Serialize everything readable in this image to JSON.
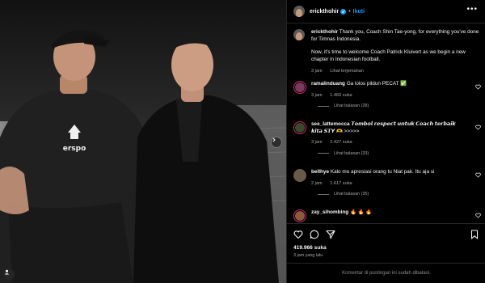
{
  "post": {
    "username": "erickthohir",
    "follow_label": "Ikuti",
    "separator": "•",
    "more_label": "•••",
    "caption_line1": "Thank you, Coach Shin Tae-yong, for everything you've done for Timnas Indonesia.",
    "caption_line2": "Now, it's time to welcome Coach Patrick Kluivert as we begin a new chapter in Indonesian football.",
    "caption_time": "3 jam",
    "translate_label": "Lihat terjemahan"
  },
  "photo": {
    "shirt_brand": "erspo"
  },
  "comments": [
    {
      "username": "ramalinduang",
      "text": "Ga lolos pildun PECAT ✅",
      "time": "3 jam",
      "likes": "1.460 suka",
      "replies": "Lihat balasan (28)",
      "avatar_color": "#7a3a5c",
      "story_ring": true
    },
    {
      "username": "see_lattemocca",
      "text": "𝙏𝙤𝙢𝙗𝙤𝙡 𝙧𝙚𝙨𝙥𝙚𝙘𝙩 𝙪𝙣𝙩𝙪𝙠 𝘾𝙤𝙖𝙘𝙝 𝙩𝙚𝙧𝙗𝙖𝙞𝙠 𝙠𝙞𝙩𝙖 𝙎𝙏𝙔 🫶 >>>>>",
      "time": "3 jam",
      "likes": "2.427 suka",
      "replies": "Lihat balasan (33)",
      "avatar_color": "#3b4a2a",
      "story_ring": true
    },
    {
      "username": "bellhye",
      "text": "Kalo mo apresiasi orang tu Niat pak. Itu aja si",
      "time": "2 jam",
      "likes": "1.617 suka",
      "replies": "Lihat balasan (35)",
      "avatar_color": "#6b5a4a",
      "story_ring": false
    },
    {
      "username": "zay_sihombing",
      "text": "🔥 🔥 🔥",
      "avatar_color": "#8a5a3a",
      "story_ring": true
    }
  ],
  "stats": {
    "likes": "419.966 suka",
    "time_ago": "3 jam yang lalu"
  },
  "footer": {
    "note": "Komentar di postingan ini sudah dibatasi."
  },
  "colors": {
    "accent_blue": "#0095f6",
    "verified_blue": "#1d9bf0",
    "muted": "#a8a8a8"
  }
}
